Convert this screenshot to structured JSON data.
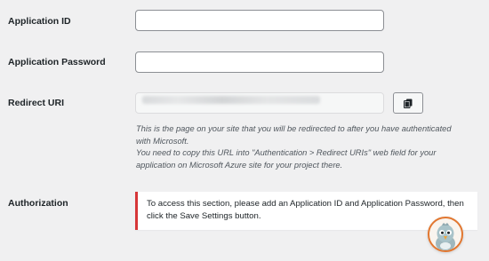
{
  "fields": {
    "application_id": {
      "label": "Application ID",
      "value": "",
      "placeholder": ""
    },
    "application_password": {
      "label": "Application Password",
      "value": "",
      "placeholder": ""
    },
    "redirect_uri": {
      "label": "Redirect URI",
      "copy_icon": "copy-icon",
      "description_line1": "This is the page on your site that you will be redirected to after you have authenticated with Microsoft.",
      "description_line2": "You need to copy this URL into \"Authentication > Redirect URIs\" web field for your application on Microsoft Azure site for your project there."
    }
  },
  "authorization": {
    "label": "Authorization",
    "notice": "To access this section, please add an Application ID and Application Password, then click the Save Settings button."
  },
  "colors": {
    "background": "#f0f0f1",
    "notice_border": "#d63638",
    "mascot_ring": "#e27730"
  },
  "mascot": {
    "icon": "bird-mascot-icon"
  }
}
